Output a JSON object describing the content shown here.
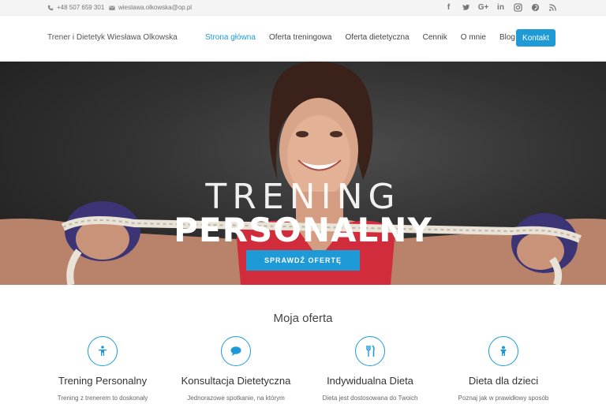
{
  "topbar": {
    "phone": "+48 507 659 301",
    "email": "wieslawa.olkowska@op.pl",
    "socials": [
      {
        "icon": "facebook-icon",
        "glyph": "f"
      },
      {
        "icon": "twitter-icon",
        "glyph": ""
      },
      {
        "icon": "google-plus-icon",
        "glyph": "G+"
      },
      {
        "icon": "linkedin-icon",
        "glyph": "in"
      },
      {
        "icon": "instagram-icon",
        "glyph": ""
      },
      {
        "icon": "pinterest-icon",
        "glyph": ""
      },
      {
        "icon": "rss-icon",
        "glyph": ""
      }
    ]
  },
  "header": {
    "brand": "Trener i Dietetyk Wiesława Olkowska",
    "nav": [
      "Strona główna",
      "Oferta treningowa",
      "Oferta dietetyczna",
      "Cennik",
      "O mnie",
      "Blog"
    ],
    "active_nav": "Strona główna",
    "cta": "Kontakt"
  },
  "hero": {
    "title_line1": "TRENING",
    "title_line2": "PERSONALNY",
    "button": "SPRAWDŹ OFERTĘ"
  },
  "offer": {
    "heading": "Moja oferta",
    "cards": [
      {
        "icon": "person-icon",
        "title": "Trening Personalny",
        "text": "Trening z trenerem to doskonały"
      },
      {
        "icon": "chat-bubble-icon",
        "title": "Konsultacja Dietetyczna",
        "text": "Jednorazowe spotkanie, na którym"
      },
      {
        "icon": "cutlery-icon",
        "title": "Indywidualna Dieta",
        "text": "Dieta jest dostosowana do Twoich"
      },
      {
        "icon": "child-icon",
        "title": "Dieta dla dzieci",
        "text": "Poznaj jak w prawidłowy sposób"
      }
    ]
  },
  "colors": {
    "accent": "#1e9ad6",
    "topbar_bg": "#f4f4f4",
    "hero_bg": "#333232"
  }
}
